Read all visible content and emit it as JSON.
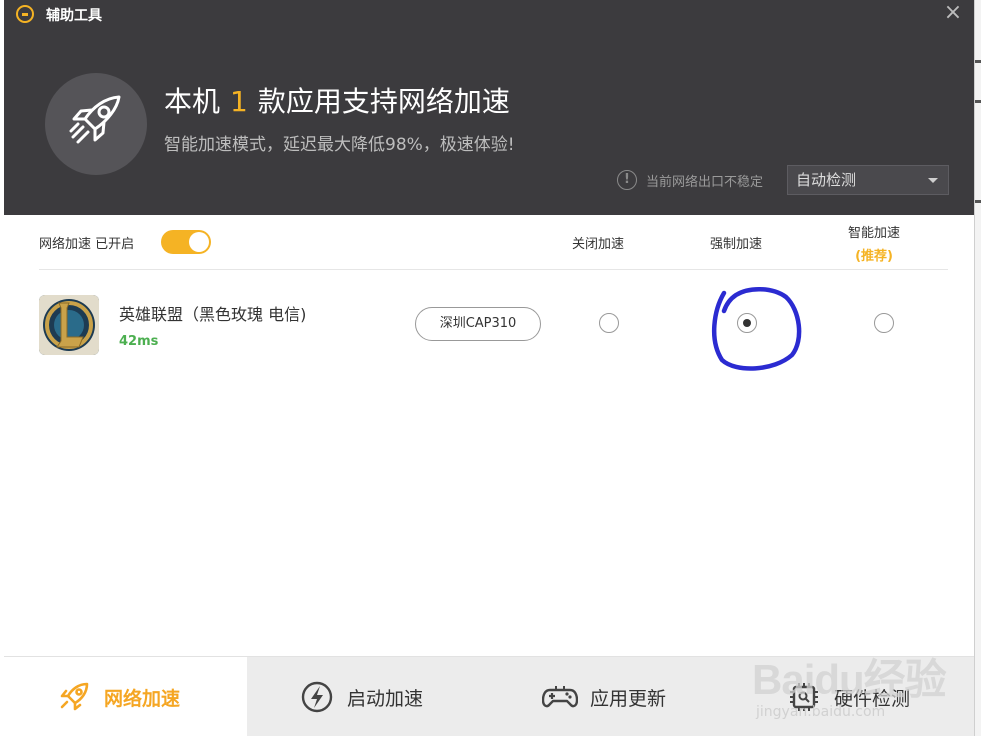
{
  "window": {
    "title": "辅助工具",
    "close_symbol": "×"
  },
  "header": {
    "headline_prefix": "本机",
    "headline_count": "1",
    "headline_suffix": "款应用支持网络加速",
    "subline": "智能加速模式，延迟最大降低98%，极速体验!",
    "network_warning": "当前网络出口不稳定",
    "warning_symbol": "!",
    "detect_select": "自动检测"
  },
  "content": {
    "toggle_label": "网络加速 已开启",
    "toggle_on": true,
    "columns": {
      "off": "关闭加速",
      "force": "强制加速",
      "smart": "智能加速",
      "smart_note": "(推荐)"
    },
    "games": [
      {
        "name": "英雄联盟（黑色玫瑰 电信)",
        "ping": "42ms",
        "server": "深圳CAP310",
        "selected_mode": "force"
      }
    ]
  },
  "bottom_nav": [
    {
      "label": "网络加速",
      "icon": "rocket-icon",
      "active": true
    },
    {
      "label": "启动加速",
      "icon": "lightning-icon",
      "active": false
    },
    {
      "label": "应用更新",
      "icon": "gamepad-icon",
      "active": false
    },
    {
      "label": "硬件检测",
      "icon": "chip-icon",
      "active": false
    }
  ],
  "watermark": {
    "brand": "Baidu经验",
    "url": "jingyan.baidu.com"
  },
  "colors": {
    "accent": "#f5b324",
    "header_bg": "#3c3b3e",
    "ping_green": "#4caf50",
    "annotation_blue": "#2b2bd1"
  }
}
